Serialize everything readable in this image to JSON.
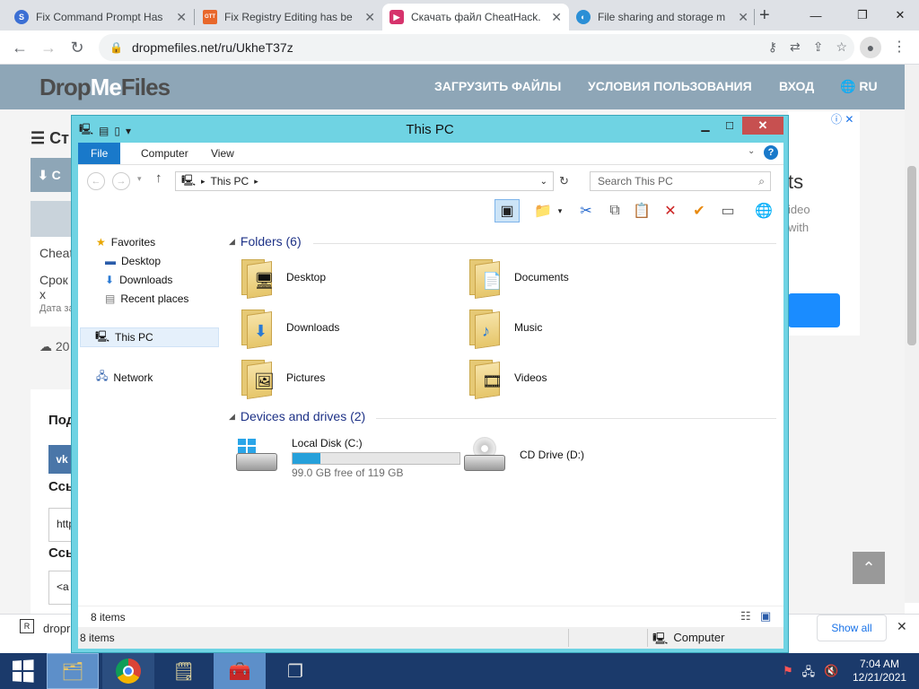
{
  "browser": {
    "tabs": [
      {
        "title": "Fix Command Prompt Has",
        "favicon": "S",
        "favicon_color": "#3b6fd4"
      },
      {
        "title": "Fix Registry Editing has be",
        "favicon": "GTT",
        "favicon_color": "#e8682c"
      },
      {
        "title": "Скачать файл CheatHack.",
        "favicon": "▶",
        "favicon_color": "#d6336c"
      },
      {
        "title": "File sharing and storage m",
        "favicon": "◐",
        "favicon_color": "#2b8fd6"
      }
    ],
    "url": "dropmefiles.net/ru/UkheT37z"
  },
  "site": {
    "logo_a": "Drop",
    "logo_b": "Me",
    "logo_c": "Files",
    "nav": [
      "ЗАГРУЗИТЬ ФАЙЛЫ",
      "УСЛОВИЯ ПОЛЬЗОВАНИЯ",
      "ВХОД",
      "RU"
    ],
    "left_fragments": {
      "heading": "Ст",
      "button": "С",
      "row1": "Cheat",
      "row2": "Срок х",
      "row3": "Дата за",
      "count": "20",
      "share_title": "Под",
      "vk": "vk",
      "link_label1": "Ссы",
      "link_value1": "http",
      "link_label2": "Ссы",
      "link_value2": "<a"
    },
    "ad_fragments": {
      "line1": "ts",
      "line2": "ideo",
      "line3": "with"
    }
  },
  "download_bar": {
    "file": "dropr",
    "show_all": "Show all"
  },
  "explorer": {
    "title": "This PC",
    "ribbon_tabs": [
      "File",
      "Computer",
      "View"
    ],
    "breadcrumb": "This PC",
    "search_placeholder": "Search This PC",
    "nav": {
      "favorites": "Favorites",
      "fav_items": [
        "Desktop",
        "Downloads",
        "Recent places"
      ],
      "this_pc": "This PC",
      "network": "Network"
    },
    "folders_header": "Folders (6)",
    "folders": [
      {
        "name": "Desktop",
        "icon": "desktop-folder-icon",
        "glyph": "🖥"
      },
      {
        "name": "Documents",
        "icon": "documents-folder-icon",
        "glyph": "📄"
      },
      {
        "name": "Downloads",
        "icon": "downloads-folder-icon",
        "glyph": "⬇"
      },
      {
        "name": "Music",
        "icon": "music-folder-icon",
        "glyph": "♪"
      },
      {
        "name": "Pictures",
        "icon": "pictures-folder-icon",
        "glyph": "🖼"
      },
      {
        "name": "Videos",
        "icon": "videos-folder-icon",
        "glyph": "🎞"
      }
    ],
    "devices_header": "Devices and drives (2)",
    "drives": [
      {
        "name": "Local Disk (C:)",
        "free": "99.0 GB free of 119 GB",
        "used_fraction": 0.168
      },
      {
        "name": "CD Drive (D:)"
      }
    ],
    "status_items": "8 items",
    "status_bottom": "8 items",
    "status_computer": "Computer"
  },
  "taskbar": {
    "time": "7:04 AM",
    "date": "12/21/2021"
  },
  "colors": {
    "ribbon_file": "#1979ca",
    "window_frame": "#6fd3e3",
    "close_button": "#c75050",
    "site_header": "#8ea6b7",
    "taskbar": "#1b3a6b",
    "progress_fill": "#26a0da"
  }
}
